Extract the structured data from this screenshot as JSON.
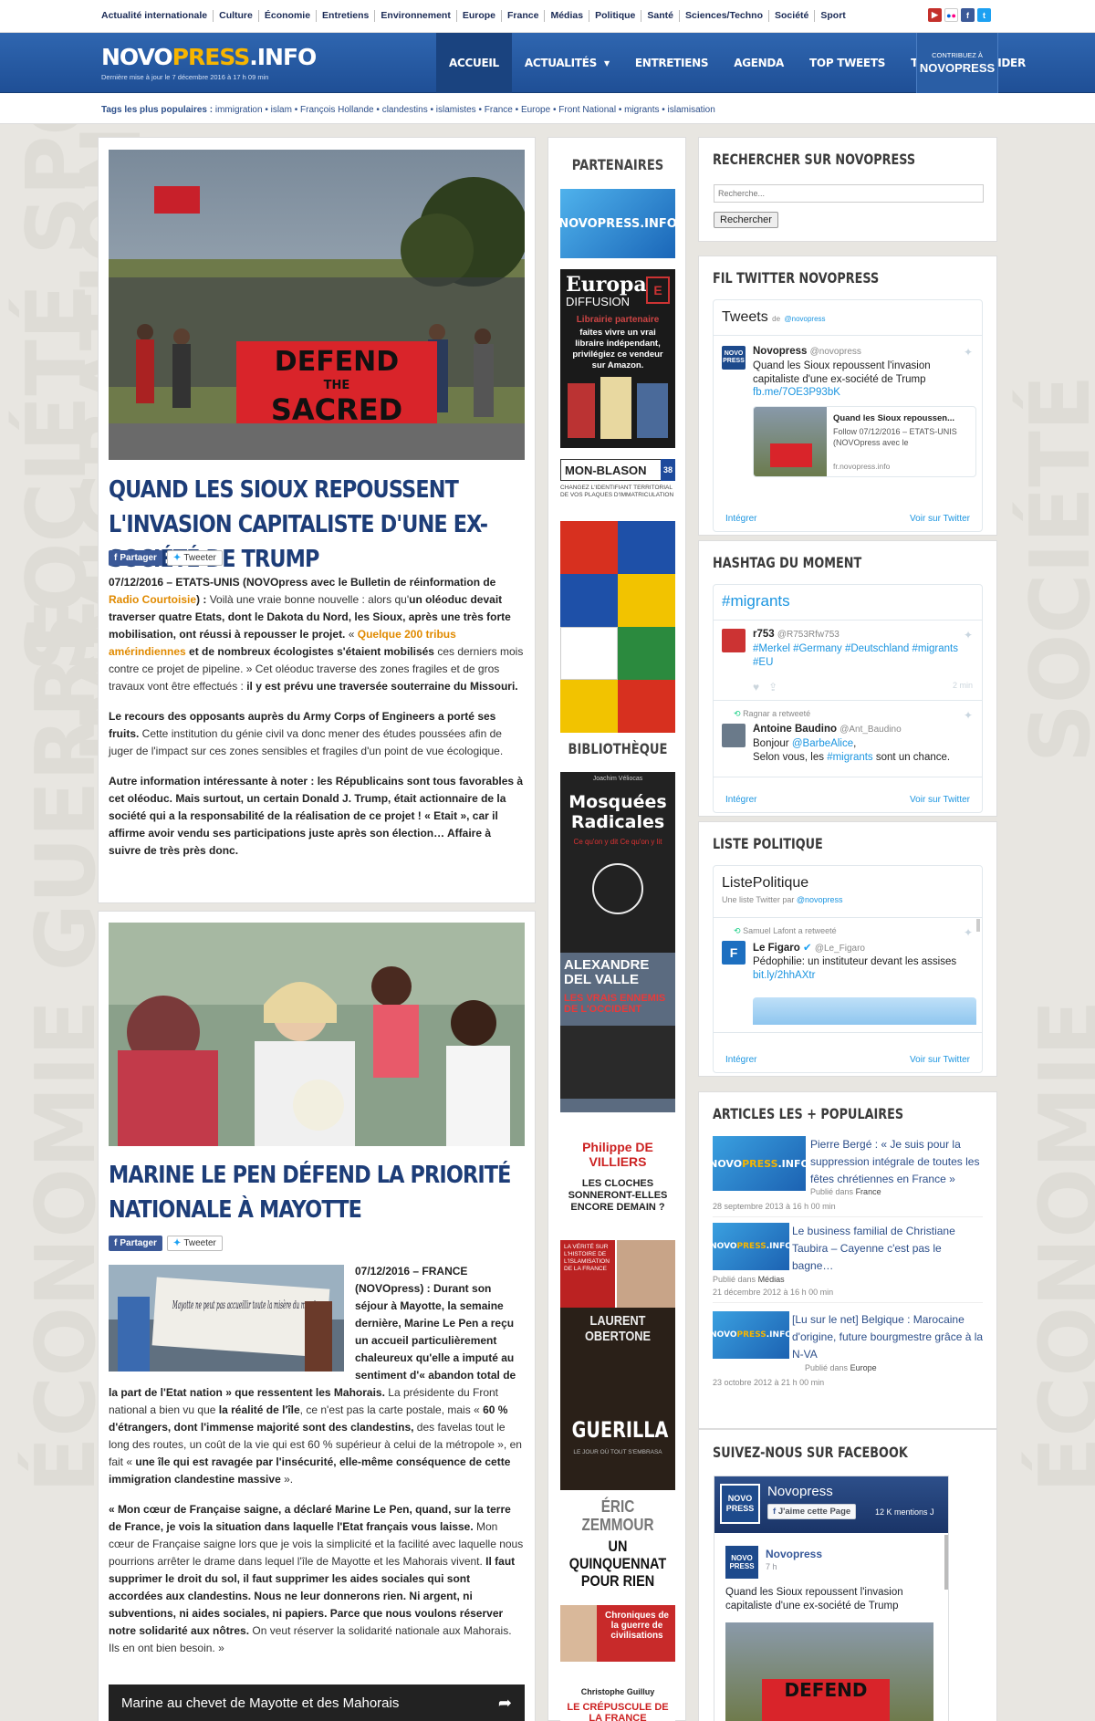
{
  "topbar": {
    "categories": [
      "Actualité internationale",
      "Culture",
      "Économie",
      "Entretiens",
      "Environnement",
      "Europe",
      "France",
      "Médias",
      "Politique",
      "Santé",
      "Sciences/Techno",
      "Société",
      "Sport"
    ]
  },
  "header": {
    "logo_part1": "NOVO",
    "logo_part2": "PRESS",
    "logo_part3": ".INFO",
    "last_update": "Dernière mise à jour le 7 décembre 2016 à 17 h 09 min",
    "nav": [
      "ACCUEIL",
      "ACTUALITÉS",
      "ENTRETIENS",
      "AGENDA",
      "TOP TWEETS",
      "TV",
      "NOUS AIDER"
    ],
    "contrib_small": "CONTRIBUEZ À",
    "contrib_big": "NOVOPRESS"
  },
  "tags": {
    "label": "Tags les plus populaires :",
    "items": [
      "immigration",
      "islam",
      "François Hollande",
      "clandestins",
      "islamistes",
      "France",
      "Europe",
      "Front National",
      "migrants",
      "islamisation"
    ]
  },
  "article1": {
    "banner_text_1": "DEFEND",
    "banner_text_2": "THE",
    "banner_text_3": "SACRED",
    "title": "QUAND LES SIOUX REPOUSSENT L'INVASION CAPITALISTE D'UNE EX-SOCIÉTÉ DE TRUMP",
    "share_fb": "Partager",
    "share_tw": "Tweeter",
    "p1_a": "07/12/2016 – ETATS-UNIS (NOVOpress avec le Bulletin de réinformation de ",
    "p1_link": "Radio Courtoisie",
    "p1_b": ") : ",
    "p1_c": "Voilà une vraie bonne nouvelle : alors qu'",
    "p1_d": "un oléoduc devait traverser quatre Etats, dont le Dakota du Nord, les Sioux, après une très forte mobilisation, ont réussi à repousser le projet.",
    "p1_e": " « ",
    "p1_link2": "Quelque 200 tribus amérindiennes",
    "p1_f": " et de nombreux écologistes s'étaient mobilisés",
    "p1_g": " ces derniers mois contre ce projet de pipeline. » Cet oléoduc traverse des zones fragiles et de gros travaux vont être effectués : ",
    "p1_h": "il y est prévu une traversée souterraine du Missouri.",
    "p2_a": "Le recours des opposants auprès du Army Corps of Engineers a porté ses fruits.",
    "p2_b": " Cette institution du génie civil va donc mener des études poussées afin de juger de l'impact sur ces zones sensibles et fragiles d'un point de vue écologique.",
    "p3": "Autre information intéressante à noter : les Républicains sont tous favorables à cet oléoduc. Mais surtout, un certain Donald J. Trump, était actionnaire de la société qui a la responsabilité de la réalisation de ce projet ! « Etait », car il affirme avoir vendu ses participations juste après son élection… Affaire à suivre de très près donc."
  },
  "article2": {
    "title": "MARINE LE PEN DÉFEND LA PRIORITÉ NATIONALE À MAYOTTE",
    "share_fb": "Partager",
    "share_tw": "Tweeter",
    "inset_text": "Mayotte ne peut pas accueillir toute la misère du monde",
    "p1_a": "07/12/2016 – FRANCE (NOVOpress) : Durant son séjour à Mayotte, la semaine dernière, Marine Le Pen a reçu un accueil particulièrement chaleureux qu'elle a imputé au sentiment d'« abandon total de la part de l'Etat nation » que ressentent les Mahorais.",
    "p1_b": " La présidente du Front national a bien vu que ",
    "p1_c": "la réalité de l'île",
    "p1_d": ", ce n'est pas la carte postale, mais « ",
    "p1_e": "60 % d'étrangers, dont l'immense majorité sont des clandestins,",
    "p1_f": " des favelas tout le long des routes, un coût de la vie qui est 60 % supérieur à celui de la métropole », en fait « ",
    "p1_g": "une île qui est ravagée par l'insécurité, elle-même conséquence de cette immigration clandestine massive",
    "p1_h": " ».",
    "p2_a": "« Mon cœur de Française saigne, a déclaré Marine Le Pen, quand, sur la terre de France, je vois la situation dans laquelle l'Etat français vous laisse.",
    "p2_b": " Mon cœur de Française saigne lors que je vois la simplicité et la facilité avec laquelle nous pourrions arrêter le drame dans lequel l'île de Mayotte et les Mahorais vivent. ",
    "p2_c": "Il faut supprimer le droit du sol, il faut supprimer les aides sociales qui sont accordées aux clandestins. Nous ne leur donnerons rien. Ni argent, ni subventions, ni aides sociales, ni papiers. Parce que nous voulons réserver notre solidarité aux nôtres.",
    "p2_d": " On veut réserver la solidarité nationale aux Mahorais. Ils en ont bien besoin. »",
    "video_title": "Marine au chevet de Mayotte et des Mahorais"
  },
  "partners": {
    "title": "PARTENAIRES",
    "novo": "NOVOPRESS.INFO",
    "europa_title": "Europa",
    "europa_sub": "DIFFUSION",
    "europa_tag": "Librairie partenaire",
    "europa_text": "faites vivre un vrai libraire indépendant, privilégiez ce vendeur sur Amazon.",
    "blason_title": "MON-BLASON",
    "blason_num": "38",
    "blason_sub": "CHANGEZ L'IDENTIFIANT TERRITORIAL DE VOS PLAQUES D'IMMATRICULATION",
    "biblio_title": "BIBLIOTHÈQUE",
    "book1_author": "Joachim Véliocas",
    "book1_title": "Mosquées Radicales",
    "book1_sub": "Ce qu'on y dit Ce qu'on y lit",
    "book2_author": "ALEXANDRE DEL VALLE",
    "book2_title": "LES VRAIS ENNEMIS DE L'OCCIDENT",
    "book3_author": "Philippe DE VILLIERS",
    "book3_title": "LES CLOCHES SONNERONT-ELLES ENCORE DEMAIN ?",
    "book3_side": "LA VÉRITÉ SUR L'HISTOIRE DE L'ISLAMISATION DE LA FRANCE",
    "book4_author": "LAURENT OBERTONE",
    "book4_title": "GUERILLA",
    "book4_sub": "LE JOUR OÙ TOUT S'EMBRASA",
    "book5_author": "ÉRIC ZEMMOUR",
    "book5_title": "UN QUINQUENNAT POUR RIEN",
    "book5_sub": "Chroniques de la guerre de civilisations",
    "book6_author": "Christophe Guilluy",
    "book6_title": "LE CRÉPUSCULE DE LA FRANCE"
  },
  "search": {
    "title": "RECHERCHER SUR NOVOPRESS",
    "placeholder": "Recherche...",
    "button": "Rechercher"
  },
  "twitter": {
    "title": "FIL TWITTER NOVOPRESS",
    "header": "Tweets",
    "header_by": "de",
    "handle": "@novopress",
    "avatar": "NOVO PRESS",
    "author": "Novopress",
    "author_handle": "@novopress",
    "text": "Quand les Sioux repoussent l'invasion capitaliste d'une ex-société de Trump",
    "link": "fb.me/7OE3P93bK",
    "card_title": "Quand les Sioux repoussen...",
    "card_text": "Follow 07/12/2016 – ETATS-UNIS (NOVOpress avec le",
    "card_domain": "fr.novopress.info",
    "embed": "Intégrer",
    "view": "Voir sur Twitter"
  },
  "hashtag": {
    "title": "HASHTAG DU MOMENT",
    "tag": "#migrants",
    "t1_author": "r753",
    "t1_handle": "@R753Rfw753",
    "t1_text": "#Merkel #Germany #Deutschland #migrants #EU",
    "t1_time": "2 min",
    "rt_label": "Ragnar a retweeté",
    "t2_author": "Antoine Baudino",
    "t2_handle": "@Ant_Baudino",
    "t2_text_a": "Bonjour ",
    "t2_mention": "@BarbeAlice",
    "t2_text_b": ",",
    "t2_text_c": "Selon vous, les ",
    "t2_tag": "#migrants",
    "t2_text_d": " sont un chance.",
    "embed": "Intégrer",
    "view": "Voir sur Twitter"
  },
  "liste": {
    "title": "LISTE POLITIQUE",
    "header": "ListePolitique",
    "sub_a": "Une liste Twitter par ",
    "sub_handle": "@novopress",
    "rt_label": "Samuel Lafont a retweeté",
    "author": "Le Figaro",
    "handle": "@Le_Figaro",
    "text": "Pédophilie: un instituteur devant les assises",
    "link": "bit.ly/2hhAXtr",
    "embed": "Intégrer",
    "view": "Voir sur Twitter"
  },
  "popular": {
    "title": "ARTICLES LES + POPULAIRES",
    "published_in": "Publié dans",
    "items": [
      {
        "title": "Pierre Bergé : « Je suis pour la suppression intégrale de toutes les fêtes chrétiennes en France »",
        "category": "France",
        "date": "28 septembre 2013 à 16 h 00 min"
      },
      {
        "title": "Le business familial de Christiane Taubira – Cayenne c'est pas le bagne…",
        "category": "Médias",
        "date": "21 décembre 2012 à 16 h 00 min"
      },
      {
        "title": "[Lu sur le net] Belgique : Marocaine d'origine, future bourgmestre grâce à la N-VA",
        "category": "Europe",
        "date": "23 octobre 2012 à 21 h 00 min"
      }
    ]
  },
  "facebook": {
    "title": "SUIVEZ-NOUS SUR FACEBOOK",
    "page_name": "Novopress",
    "like": "J'aime cette Page",
    "likes_count": "12 K mentions J",
    "post_author": "Novopress",
    "post_time": "7 h",
    "post_text": "Quand les Sioux repoussent l'invasion capitaliste d'une ex-société de Trump",
    "avatar": "NOVO PRESS",
    "banner": "DEFEND"
  },
  "colors": {
    "brand_blue": "#2a5ea5",
    "title_blue": "#1d3d78",
    "accent_yellow": "#f7b500",
    "link_orange": "#e08a00",
    "twitter_blue": "#1b95e0"
  }
}
